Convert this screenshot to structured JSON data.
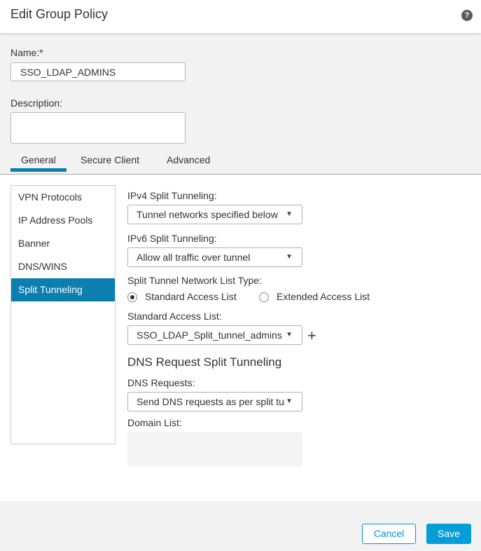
{
  "dialog": {
    "title": "Edit Group Policy",
    "help_icon": "question-circle-icon"
  },
  "form": {
    "name_label": "Name:*",
    "name_value": "SSO_LDAP_ADMINS",
    "description_label": "Description:",
    "description_value": ""
  },
  "tabs": [
    {
      "label": "General",
      "active": true
    },
    {
      "label": "Secure Client",
      "active": false
    },
    {
      "label": "Advanced",
      "active": false
    }
  ],
  "side_nav": {
    "items": [
      {
        "label": "VPN Protocols",
        "active": false
      },
      {
        "label": "IP Address Pools",
        "active": false
      },
      {
        "label": "Banner",
        "active": false
      },
      {
        "label": "DNS/WINS",
        "active": false
      },
      {
        "label": "Split Tunneling",
        "active": true
      }
    ]
  },
  "split_tunneling": {
    "ipv4_label": "IPv4 Split Tunneling:",
    "ipv4_value": "Tunnel networks specified below",
    "ipv6_label": "IPv6 Split Tunneling:",
    "ipv6_value": "Allow all traffic over tunnel",
    "list_type_label": "Split Tunnel Network List Type:",
    "list_type_options": [
      {
        "label": "Standard Access List",
        "checked": true
      },
      {
        "label": "Extended Access List",
        "checked": false
      }
    ],
    "acl_label": "Standard Access List:",
    "acl_value": "SSO_LDAP_Split_tunnel_admins",
    "add_icon": "plus-icon"
  },
  "dns_split": {
    "title": "DNS Request Split Tunneling",
    "requests_label": "DNS Requests:",
    "requests_value": "Send DNS requests as per split tunnel policy",
    "domain_list_label": "Domain List:",
    "domain_list_value": ""
  },
  "footer": {
    "cancel_label": "Cancel",
    "save_label": "Save"
  },
  "colors": {
    "accent": "#0a7fb0",
    "save_button": "#049fd9"
  }
}
